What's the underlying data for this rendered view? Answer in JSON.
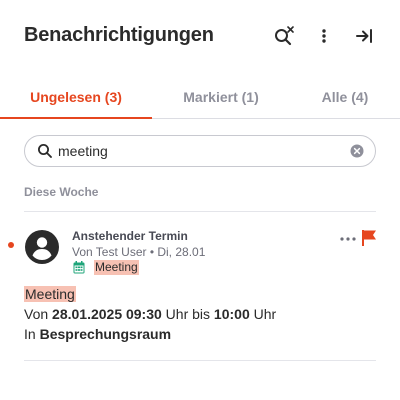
{
  "header": {
    "title": "Benachrichtigungen",
    "icons": [
      "search-clear-icon",
      "more-vertical-icon",
      "collapse-right-icon"
    ]
  },
  "tabs": [
    {
      "label": "Ungelesen (3)",
      "active": true
    },
    {
      "label": "Markiert (1)",
      "active": false
    },
    {
      "label": "Alle (4)",
      "active": false
    }
  ],
  "search": {
    "value": "meeting"
  },
  "section": {
    "label": "Diese Woche"
  },
  "notification": {
    "title": "Anstehender Termin",
    "meta": "Von Test User • Di, 28.01",
    "tag": "Meeting",
    "unread": true,
    "flagged": true,
    "body": {
      "subject": "Meeting",
      "from_prefix": "Von ",
      "start": "28.01.2025 09:30",
      "time_mid": " Uhr bis ",
      "end": "10:00",
      "time_suffix": " Uhr",
      "location_prefix": "In ",
      "location": "Besprechungsraum"
    }
  },
  "colors": {
    "accent": "#e6461f",
    "highlight": "#f7c1b3",
    "calendar_icon": "#1fa57a"
  }
}
